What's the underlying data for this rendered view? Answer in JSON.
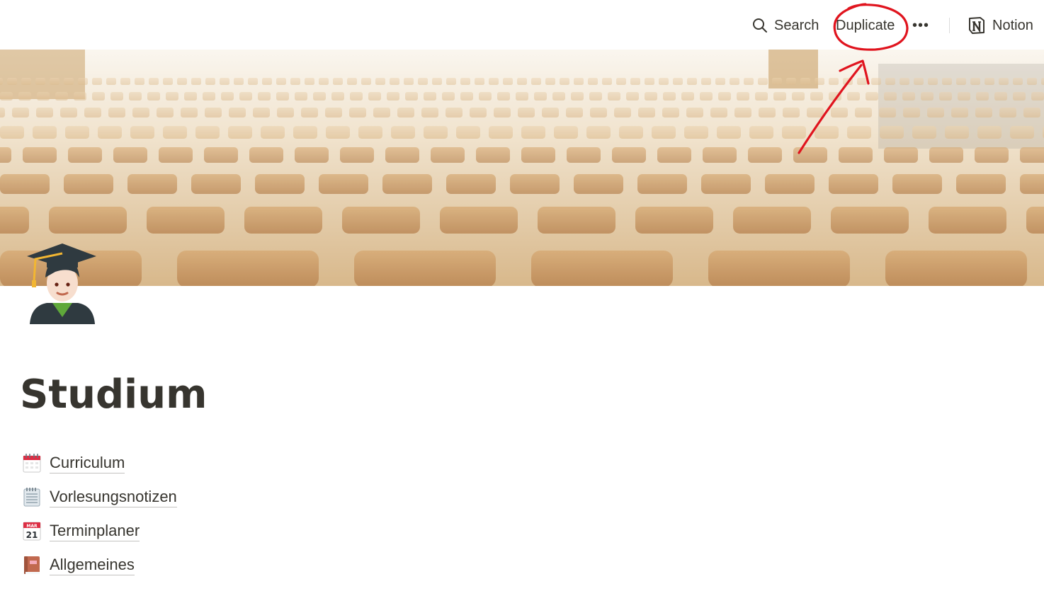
{
  "topbar": {
    "search_label": "Search",
    "search_icon": "search-icon",
    "duplicate_label": "Duplicate",
    "more_label": "•••",
    "notion_label": "Notion",
    "notion_icon": "notion-logo"
  },
  "page": {
    "icon": "graduate-emoji",
    "title": "Studium"
  },
  "links": [
    {
      "label": "Curriculum",
      "icon": "calendar-spiral-icon"
    },
    {
      "label": "Vorlesungsnotizen",
      "icon": "notepad-icon"
    },
    {
      "label": "Terminplaner",
      "icon": "calendar-date-icon"
    },
    {
      "label": "Allgemeines",
      "icon": "book-icon"
    }
  ],
  "colors": {
    "text": "#37352f",
    "annotation_red": "#e0141e"
  }
}
